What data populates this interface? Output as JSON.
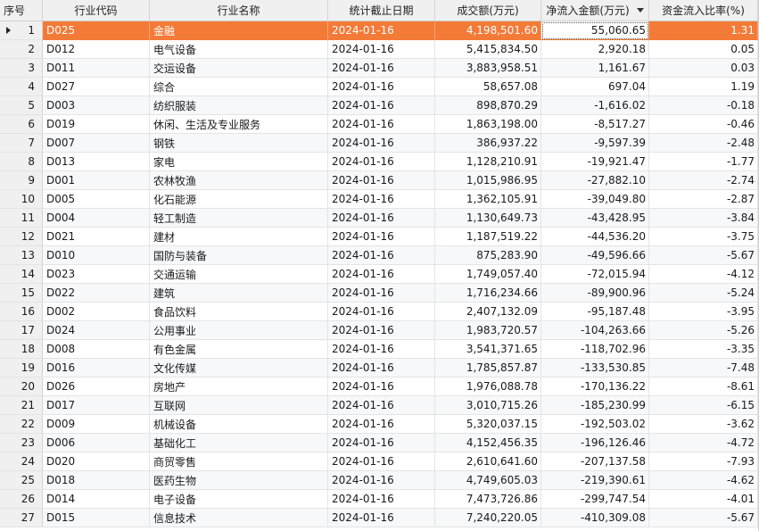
{
  "columns": [
    "序号",
    "行业代码",
    "行业名称",
    "统计截止日期",
    "成交额(万元)",
    "净流入金额(万元)",
    "资金流入比率(%)"
  ],
  "sort": {
    "column": "净流入金额(万元)",
    "direction": "desc",
    "icon": "sort-desc-icon"
  },
  "selected_row": 1,
  "accent": "#f47a38",
  "rows": [
    [
      "1",
      "D025",
      "金融",
      "2024-01-16",
      "4,198,501.60",
      "55,060.65",
      "1.31"
    ],
    [
      "2",
      "D012",
      "电气设备",
      "2024-01-16",
      "5,415,834.50",
      "2,920.18",
      "0.05"
    ],
    [
      "3",
      "D011",
      "交运设备",
      "2024-01-16",
      "3,883,958.51",
      "1,161.67",
      "0.03"
    ],
    [
      "4",
      "D027",
      "综合",
      "2024-01-16",
      "58,657.08",
      "697.04",
      "1.19"
    ],
    [
      "5",
      "D003",
      "纺织服装",
      "2024-01-16",
      "898,870.29",
      "-1,616.02",
      "-0.18"
    ],
    [
      "6",
      "D019",
      "休闲、生活及专业服务",
      "2024-01-16",
      "1,863,198.00",
      "-8,517.27",
      "-0.46"
    ],
    [
      "7",
      "D007",
      "钢铁",
      "2024-01-16",
      "386,937.22",
      "-9,597.39",
      "-2.48"
    ],
    [
      "8",
      "D013",
      "家电",
      "2024-01-16",
      "1,128,210.91",
      "-19,921.47",
      "-1.77"
    ],
    [
      "9",
      "D001",
      "农林牧渔",
      "2024-01-16",
      "1,015,986.95",
      "-27,882.10",
      "-2.74"
    ],
    [
      "10",
      "D005",
      "化石能源",
      "2024-01-16",
      "1,362,105.91",
      "-39,049.80",
      "-2.87"
    ],
    [
      "11",
      "D004",
      "轻工制造",
      "2024-01-16",
      "1,130,649.73",
      "-43,428.95",
      "-3.84"
    ],
    [
      "12",
      "D021",
      "建材",
      "2024-01-16",
      "1,187,519.22",
      "-44,536.20",
      "-3.75"
    ],
    [
      "13",
      "D010",
      "国防与装备",
      "2024-01-16",
      "875,283.90",
      "-49,596.66",
      "-5.67"
    ],
    [
      "14",
      "D023",
      "交通运输",
      "2024-01-16",
      "1,749,057.40",
      "-72,015.94",
      "-4.12"
    ],
    [
      "15",
      "D022",
      "建筑",
      "2024-01-16",
      "1,716,234.66",
      "-89,900.96",
      "-5.24"
    ],
    [
      "16",
      "D002",
      "食品饮料",
      "2024-01-16",
      "2,407,132.09",
      "-95,187.48",
      "-3.95"
    ],
    [
      "17",
      "D024",
      "公用事业",
      "2024-01-16",
      "1,983,720.57",
      "-104,263.66",
      "-5.26"
    ],
    [
      "18",
      "D008",
      "有色金属",
      "2024-01-16",
      "3,541,371.65",
      "-118,702.96",
      "-3.35"
    ],
    [
      "19",
      "D016",
      "文化传媒",
      "2024-01-16",
      "1,785,857.87",
      "-133,530.85",
      "-7.48"
    ],
    [
      "20",
      "D026",
      "房地产",
      "2024-01-16",
      "1,976,088.78",
      "-170,136.22",
      "-8.61"
    ],
    [
      "21",
      "D017",
      "互联网",
      "2024-01-16",
      "3,010,715.26",
      "-185,230.99",
      "-6.15"
    ],
    [
      "22",
      "D009",
      "机械设备",
      "2024-01-16",
      "5,320,037.15",
      "-192,503.02",
      "-3.62"
    ],
    [
      "23",
      "D006",
      "基础化工",
      "2024-01-16",
      "4,152,456.35",
      "-196,126.46",
      "-4.72"
    ],
    [
      "24",
      "D020",
      "商贸零售",
      "2024-01-16",
      "2,610,641.60",
      "-207,137.58",
      "-7.93"
    ],
    [
      "25",
      "D018",
      "医药生物",
      "2024-01-16",
      "4,749,605.03",
      "-219,390.61",
      "-4.62"
    ],
    [
      "26",
      "D014",
      "电子设备",
      "2024-01-16",
      "7,473,726.86",
      "-299,747.54",
      "-4.01"
    ],
    [
      "27",
      "D015",
      "信息技术",
      "2024-01-16",
      "7,240,220.05",
      "-410,309.08",
      "-5.67"
    ]
  ]
}
